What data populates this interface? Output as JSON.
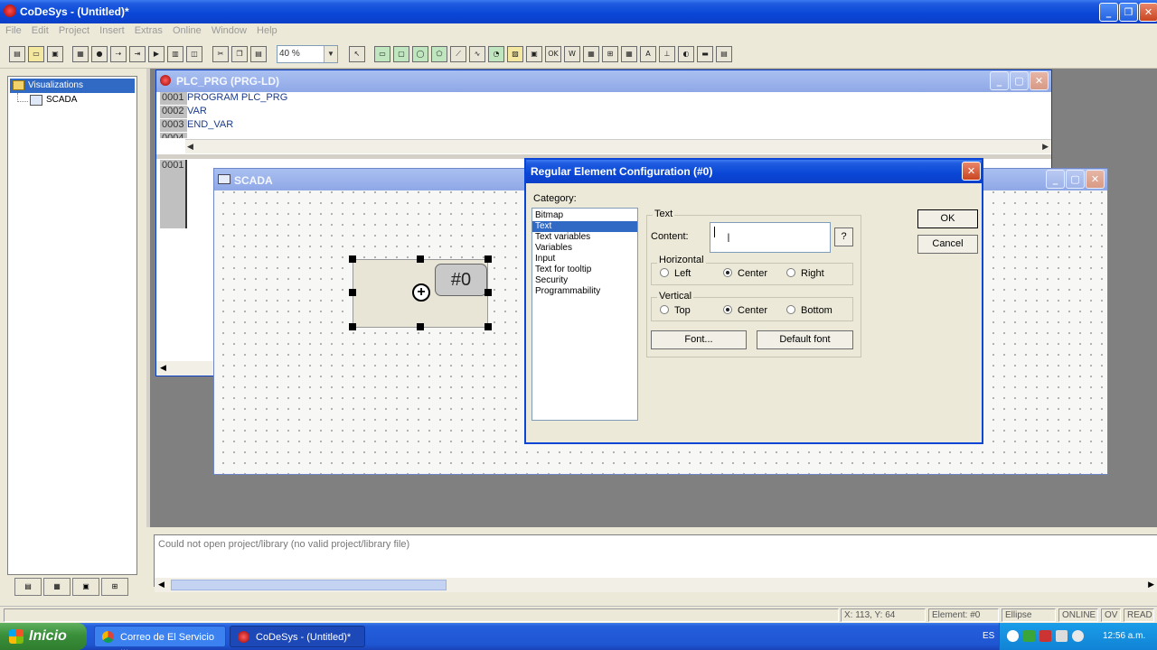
{
  "app": {
    "title": "CoDeSys - (Untitled)*",
    "menu": [
      "File",
      "Edit",
      "Project",
      "Insert",
      "Extras",
      "Online",
      "Window",
      "Help"
    ],
    "zoom": "40 %"
  },
  "tree": {
    "root": "Visualizations",
    "child": "SCADA"
  },
  "plc_window": {
    "title": "PLC_PRG (PRG-LD)",
    "lines": [
      {
        "num": "0001",
        "code": "PROGRAM PLC_PRG"
      },
      {
        "num": "0002",
        "code": "VAR"
      },
      {
        "num": "0003",
        "code": "END_VAR"
      },
      {
        "num": "0004",
        "code": ""
      }
    ],
    "ld_line": "0001"
  },
  "scada_window": {
    "title": "SCADA",
    "element_label": "#0"
  },
  "dialog": {
    "title": "Regular Element Configuration (#0)",
    "category_label": "Category:",
    "categories": [
      "Bitmap",
      "Text",
      "Text variables",
      "Variables",
      "Input",
      "Text for tooltip",
      "Security",
      "Programmability"
    ],
    "selected_category": "Text",
    "text_group": "Text",
    "content_label": "Content:",
    "content_value": "",
    "help_button": "?",
    "horizontal_label": "Horizontal",
    "horizontal_options": [
      "Left",
      "Center",
      "Right"
    ],
    "horizontal_selected": "Center",
    "vertical_label": "Vertical",
    "vertical_options": [
      "Top",
      "Center",
      "Bottom"
    ],
    "vertical_selected": "Center",
    "font_button": "Font...",
    "default_font_button": "Default font",
    "ok_button": "OK",
    "cancel_button": "Cancel"
  },
  "messages": {
    "text": "Could not open project/library (no valid project/library file)"
  },
  "status": {
    "coords": "X:    113, Y:      64",
    "element": "Element: #0",
    "shape": "Ellipse",
    "online": "ONLINE",
    "ov": "OV",
    "read": "READ"
  },
  "taskbar": {
    "start": "Inicio",
    "tasks": [
      "Correo de El Servicio ...",
      "CoDeSys - (Untitled)*"
    ],
    "lang": "ES",
    "time": "12:56 a.m."
  },
  "colors": {
    "title_active": "#0a46d6",
    "selection": "#316ac5",
    "face": "#ece9d8"
  }
}
